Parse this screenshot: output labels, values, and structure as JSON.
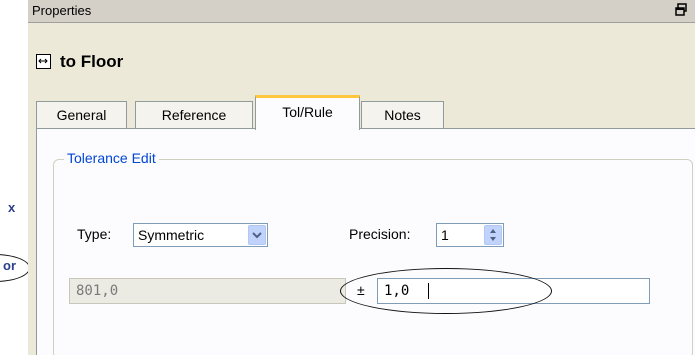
{
  "background": {
    "line1": "x",
    "line2": "or"
  },
  "window": {
    "title": "Properties",
    "dock_icon": "dock-restore-icon"
  },
  "header": {
    "icon": "dimension-arrow-icon",
    "label": "to Floor"
  },
  "tabs": {
    "general": "General",
    "reference": "Reference",
    "tolrule": "Tol/Rule",
    "notes": "Notes",
    "active": "Tol/Rule"
  },
  "tolerance_edit": {
    "legend": "Tolerance Edit",
    "type_label": "Type:",
    "type_value": "Symmetric",
    "precision_label": "Precision:",
    "precision_value": "1",
    "nominal_value": "801,0",
    "plus_minus": "±",
    "tolerance_value": "1,0"
  },
  "colors": {
    "legend_blue": "#0046d5",
    "active_tab_highlight": "#ffc83c",
    "background_text": "#2b3f8a"
  }
}
